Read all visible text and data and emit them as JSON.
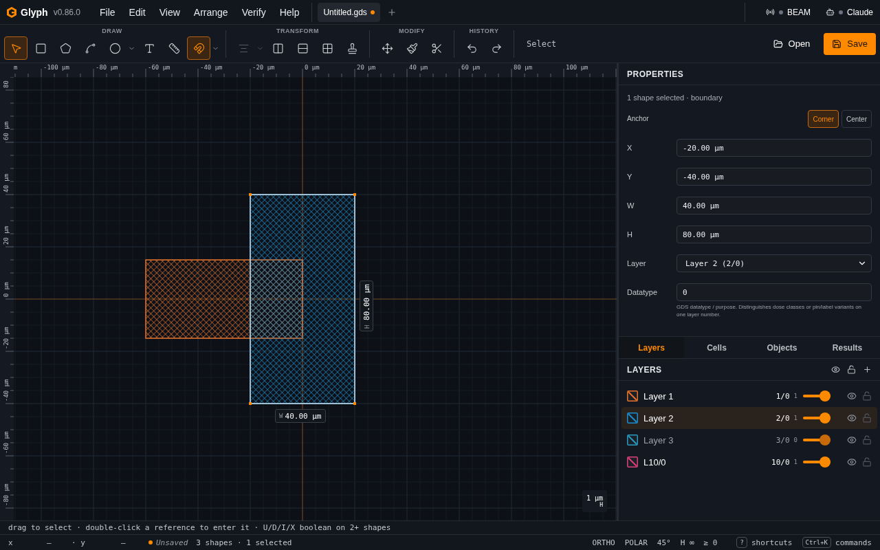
{
  "app": {
    "name": "Glyph",
    "version": "v0.86.0"
  },
  "menu": [
    "File",
    "Edit",
    "View",
    "Arrange",
    "Verify",
    "Help"
  ],
  "document_tabs": [
    {
      "title": "Untitled.gds",
      "unsaved": true,
      "selected": true
    }
  ],
  "status_indicators": [
    {
      "kind": "beam",
      "label": "BEAM",
      "connected": false
    },
    {
      "kind": "assistant",
      "label": "Claude",
      "connected": false
    }
  ],
  "toolbar": {
    "groups": [
      {
        "label": "DRAW",
        "tools": [
          {
            "kind": "select",
            "selected": true,
            "disabled": false,
            "dropdown": false
          },
          {
            "kind": "rectangle",
            "selected": false,
            "disabled": false,
            "dropdown": false
          },
          {
            "kind": "polygon",
            "selected": false,
            "disabled": false,
            "dropdown": false
          },
          {
            "kind": "path",
            "selected": false,
            "disabled": false,
            "dropdown": false
          },
          {
            "kind": "ellipse",
            "selected": false,
            "disabled": false,
            "dropdown": true
          },
          {
            "kind": "text",
            "selected": false,
            "disabled": false,
            "dropdown": false
          },
          {
            "kind": "measure",
            "selected": false,
            "disabled": false,
            "dropdown": false
          },
          {
            "kind": "snap",
            "selected": true,
            "disabled": false,
            "dropdown": true
          }
        ]
      },
      {
        "label": "TRANSFORM",
        "tools": [
          {
            "kind": "align",
            "selected": false,
            "disabled": true,
            "dropdown": true
          },
          {
            "kind": "mirror_h",
            "selected": false,
            "disabled": false,
            "dropdown": false
          },
          {
            "kind": "mirror_v",
            "selected": false,
            "disabled": false,
            "dropdown": false
          },
          {
            "kind": "array",
            "selected": false,
            "disabled": false,
            "dropdown": false
          },
          {
            "kind": "stamp",
            "selected": false,
            "disabled": false,
            "dropdown": false
          }
        ]
      },
      {
        "label": "MODIFY",
        "tools": [
          {
            "kind": "move",
            "selected": false,
            "disabled": false,
            "dropdown": false
          },
          {
            "kind": "brush",
            "selected": false,
            "disabled": false,
            "dropdown": false
          },
          {
            "kind": "cut",
            "selected": false,
            "disabled": false,
            "dropdown": false
          }
        ]
      },
      {
        "label": "HISTORY",
        "tools": [
          {
            "kind": "undo",
            "selected": false,
            "disabled": false,
            "dropdown": false
          },
          {
            "kind": "redo",
            "selected": false,
            "disabled": false,
            "dropdown": false
          }
        ]
      }
    ],
    "mode": "Select",
    "actions": [
      {
        "kind": "open",
        "label": "Open"
      },
      {
        "kind": "save",
        "label": "Save"
      }
    ]
  },
  "canvas": {
    "x_ruler": [
      "m",
      "-100 µm",
      "-80 µm",
      "-60 µm",
      "-40 µm",
      "-20 µm",
      "0 µm",
      "20 µm",
      "40 µm",
      "60 µm",
      "80 µm",
      "100 µm"
    ],
    "y_ruler": [
      "80",
      "60 µm",
      "40 µm",
      "20 µm",
      "0 µm",
      "-20 µm",
      "-40 µm",
      "-60 µm",
      "-80 µm"
    ],
    "shapes": [
      {
        "selected": false
      },
      {
        "selected": true
      }
    ],
    "height_dimension": {
      "axis": "H",
      "value": "80.00 µm"
    },
    "width_dimension": {
      "axis": "W",
      "value": "40.00 µm"
    },
    "scale": {
      "value": "1 µm",
      "axis": "H"
    }
  },
  "properties": {
    "title": "PROPERTIES",
    "selection": "1 shape selected · boundary",
    "anchor": {
      "label": "Anchor",
      "options": [
        {
          "label": "Corner",
          "selected": true
        },
        {
          "label": "Center",
          "selected": false
        }
      ]
    },
    "fields": [
      {
        "kind": "input",
        "label": "X",
        "value": "-20.00 µm"
      },
      {
        "kind": "input",
        "label": "Y",
        "value": "-40.00 µm"
      },
      {
        "kind": "input",
        "label": "W",
        "value": "40.00 µm"
      },
      {
        "kind": "input",
        "label": "H",
        "value": "80.00 µm"
      },
      {
        "kind": "select",
        "label": "Layer",
        "value": "Layer 2 (2/0)"
      },
      {
        "kind": "input",
        "label": "Datatype",
        "value": "0",
        "help": "GDS datatype / purpose. Distinguishes dose classes or pin/label variants on one layer number."
      }
    ]
  },
  "panel_tabs": [
    {
      "label": "Layers",
      "selected": true
    },
    {
      "label": "Cells",
      "selected": false
    },
    {
      "label": "Objects",
      "selected": false
    },
    {
      "label": "Results",
      "selected": false
    }
  ],
  "layers": {
    "title": "LAYERS",
    "items": [
      {
        "name": "Layer 1",
        "code": "1/0",
        "count": "1",
        "color": "#e8742c",
        "level": 1,
        "selected": false,
        "visible": true
      },
      {
        "name": "Layer 2",
        "code": "2/0",
        "count": "1",
        "color": "#1e8fd0",
        "level": 1,
        "selected": true,
        "visible": true
      },
      {
        "name": "Layer 3",
        "code": "3/0",
        "count": "0",
        "color": "#2a9cc4",
        "level": 1,
        "selected": false,
        "visible": false
      },
      {
        "name": "L10/0",
        "code": "10/0",
        "count": "1",
        "color": "#e0407a",
        "level": 1,
        "selected": false,
        "visible": true
      }
    ]
  },
  "hint": "drag to select · double-click a reference to enter it · U/D/I/X boolean on 2+ shapes",
  "status_bar": {
    "x_label": "x",
    "x_value": "—",
    "y_label": "· y",
    "y_value": "—",
    "saved": false,
    "save_state": "Unsaved",
    "summary": "3 shapes · 1 selected",
    "modes": [
      "ORTHO",
      "POLAR",
      "45°",
      "H ∞",
      "≥ 0"
    ],
    "shortcuts": [
      {
        "key": "?",
        "label": "shortcuts"
      },
      {
        "key": "Ctrl+K",
        "label": "commands"
      }
    ]
  }
}
